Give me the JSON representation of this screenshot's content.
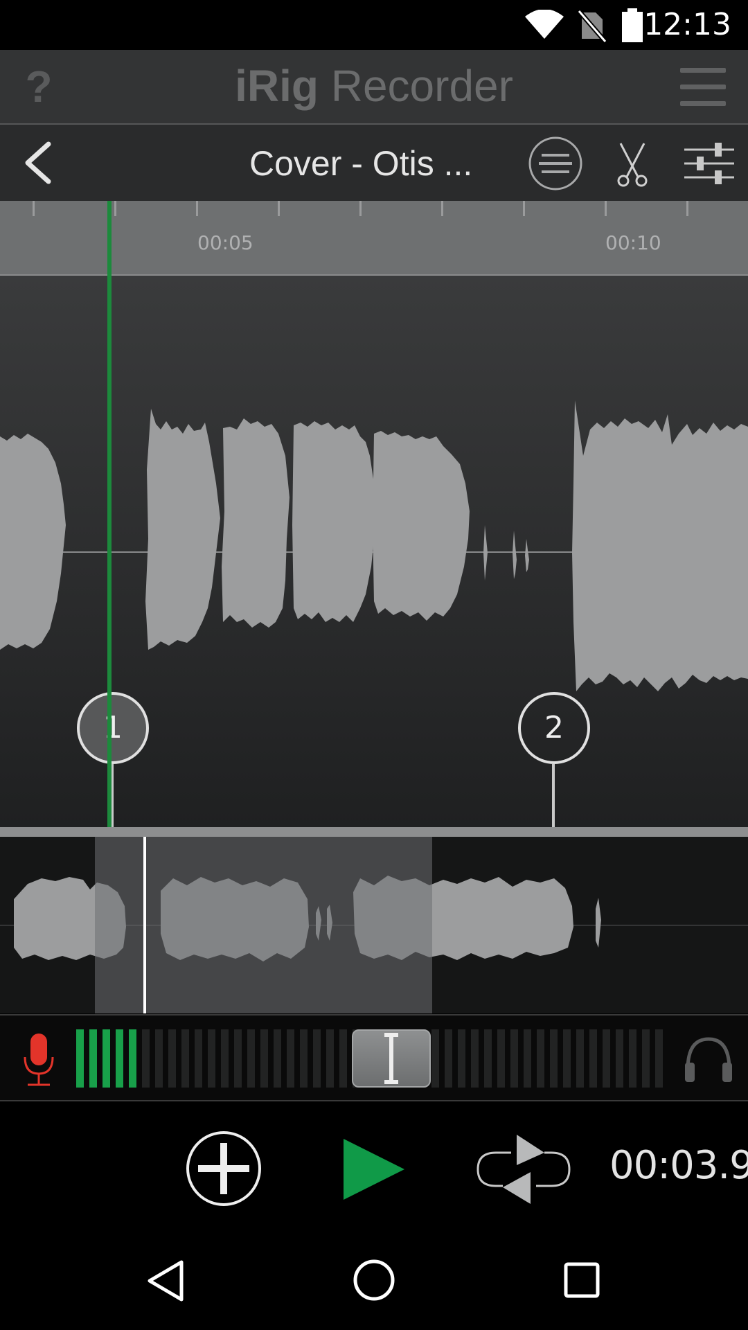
{
  "status_bar": {
    "time": "12:13",
    "icons": [
      "wifi-icon",
      "no-sim-icon",
      "battery-icon"
    ]
  },
  "header": {
    "help_label": "?",
    "title_bold": "iRig",
    "title_light": " Recorder",
    "menu_icon": "hamburger-menu-icon"
  },
  "file_bar": {
    "back_icon": "chevron-left-icon",
    "title": "Cover - Otis ...",
    "actions": [
      "list-icon",
      "scissors-icon",
      "mixer-sliders-icon"
    ]
  },
  "ruler": {
    "labels": [
      "00:05",
      "00:10"
    ]
  },
  "markers": [
    {
      "label": "1"
    },
    {
      "label": "2"
    }
  ],
  "meter": {
    "input_icon": "microphone-icon",
    "output_icon": "headphones-icon",
    "active_segments": 5,
    "total_segments": 45,
    "monitor_level": 0.53
  },
  "transport": {
    "add_icon": "add-marker-icon",
    "play_icon": "play-icon",
    "loop_icon": "loop-icon",
    "time": "00:03.9"
  },
  "colors": {
    "accent_green": "#18a04a",
    "mic_red": "#e3342a",
    "waveform": "#9c9d9e"
  },
  "nav": {
    "back_icon": "nav-back-icon",
    "home_icon": "nav-home-icon",
    "recents_icon": "nav-recents-icon"
  }
}
